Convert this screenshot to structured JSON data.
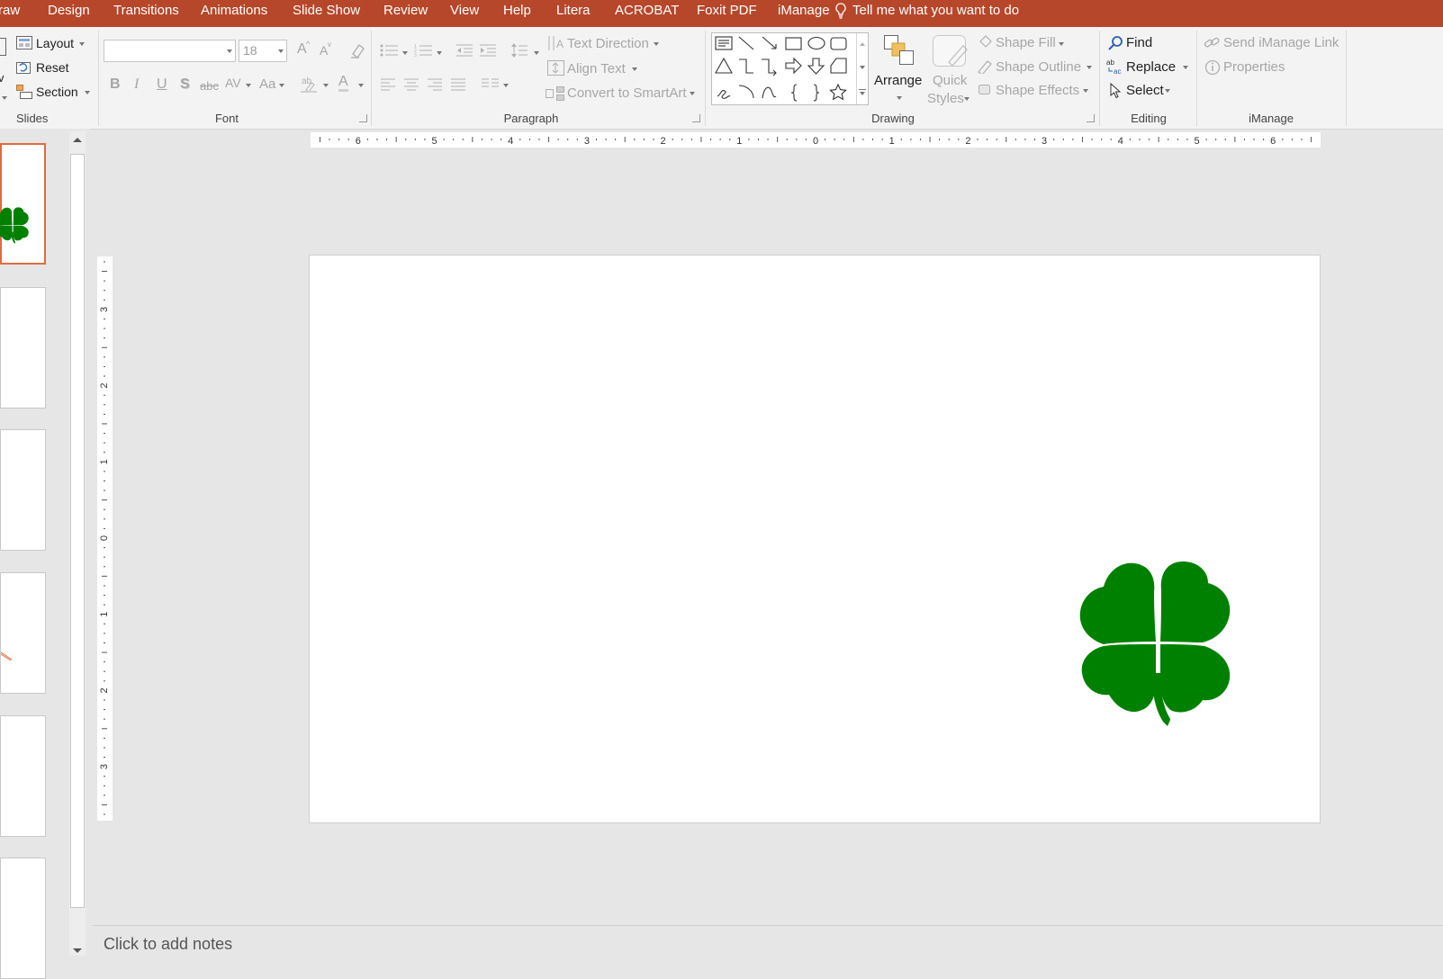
{
  "menu": {
    "tabs": [
      "raw",
      "Design",
      "Transitions",
      "Animations",
      "Slide Show",
      "Review",
      "View",
      "Help",
      "Litera",
      "ACROBAT",
      "Foxit PDF",
      "iManage"
    ],
    "tell_me": "Tell me what you want to do",
    "bar_color": "#b7472a"
  },
  "ribbon": {
    "slides": {
      "layout": "Layout",
      "reset": "Reset",
      "section": "Section",
      "group_label": "Slides",
      "cut_glyph": "v"
    },
    "font": {
      "name_value": "",
      "size_value": "18",
      "group_label": "Font",
      "bold": "B",
      "italic": "I",
      "underline": "U",
      "shadow": "S",
      "strike": "abc",
      "spacing": "AV",
      "case": "Aa",
      "color": "A",
      "grow": "A",
      "shrink": "A"
    },
    "paragraph": {
      "text_direction": "Text Direction",
      "align_text": "Align Text",
      "convert_smartart": "Convert to SmartArt",
      "group_label": "Paragraph"
    },
    "drawing": {
      "arrange": "Arrange",
      "quick": "Quick",
      "styles": "Styles",
      "shape_fill": "Shape Fill",
      "shape_outline": "Shape Outline",
      "shape_effects": "Shape Effects",
      "group_label": "Drawing"
    },
    "editing": {
      "find": "Find",
      "replace": "Replace",
      "select": "Select",
      "group_label": "Editing"
    },
    "imanage": {
      "send_link": "Send iManage Link",
      "properties": "Properties",
      "group_label": "iManage"
    }
  },
  "rulers": {
    "h_labels": [
      "6",
      "5",
      "4",
      "3",
      "2",
      "1",
      "0",
      "1",
      "2",
      "3",
      "4",
      "5",
      "6"
    ],
    "v_labels": [
      "3",
      "2",
      "1",
      "0",
      "1",
      "2",
      "3"
    ]
  },
  "slide": {
    "clover_color": "#008000"
  },
  "notes": {
    "placeholder": "Click to add notes"
  },
  "accent_color": "#e06a3e"
}
